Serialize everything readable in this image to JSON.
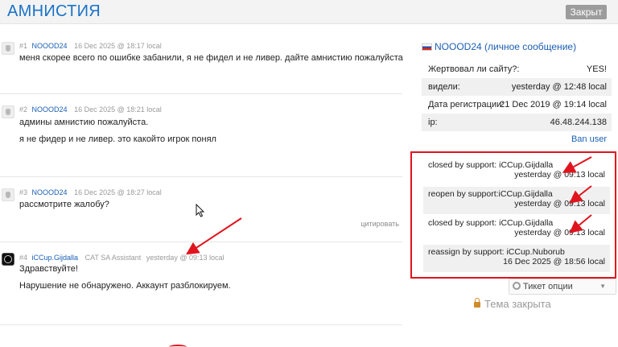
{
  "header": {
    "title": "АМНИСТИЯ",
    "status_badge": "Закрыт"
  },
  "posts": [
    {
      "number": "#1",
      "author": "NOOOD24",
      "role": "",
      "time": "16 Dec 2025 @ 18:17 local",
      "lines": [
        "меня скорее всего по ошибке забанили, я не фидел и не ливер. дайте амнистию пожалуйста"
      ]
    },
    {
      "number": "#2",
      "author": "NOOOD24",
      "role": "",
      "time": "16 Dec 2025 @ 18:21 local",
      "lines": [
        "админы амнистию пожалуйста.",
        "я не фидер и не ливер. это какойто игрок понял"
      ]
    },
    {
      "number": "#3",
      "author": "NOOOD24",
      "role": "",
      "time": "16 Dec 2025 @ 18:27 local",
      "lines": [
        "рассмотрите жалобу?"
      ],
      "quote_label": "цитировать"
    },
    {
      "number": "#4",
      "author": "iCCup.Gijdalla",
      "role": "CAT SA Assistant",
      "time": "yesterday @ 09:13 local",
      "lines": [
        "Здравствуйте!",
        "Нарушение не обнаружено. Аккаунт разблокируем."
      ]
    }
  ],
  "sidebar": {
    "user": {
      "name": "NOOOD24",
      "pm_label": "(личное сообщение)"
    },
    "info": [
      {
        "label": "Жертвовал ли сайту?:",
        "value": "YES!"
      },
      {
        "label": "видели:",
        "value": "yesterday @ 12:48 local"
      },
      {
        "label": "Дата регистрации:",
        "value": "21 Dec 2019 @ 19:14 local"
      },
      {
        "label": "ip:",
        "value": "46.48.244.138"
      }
    ],
    "ban_label": "Ban user",
    "log": [
      {
        "action": "closed by support: iCCup.Gijdalla",
        "time": "yesterday @ 09:13 local"
      },
      {
        "action": "reopen by support:iCCup.Gijdalla",
        "time": "yesterday @ 09:13 local"
      },
      {
        "action": "closed by support: iCCup.Gijdalla",
        "time": "yesterday @ 09:13 local"
      },
      {
        "action": "reassign by support: iCCup.Nuborub",
        "time": "16 Dec 2025 @ 18:56 local"
      }
    ],
    "ticket_options_label": "Тикет опции",
    "closed_label": "Тема закрыта"
  },
  "colors": {
    "accent": "#1a73c9",
    "link": "#1a5fb4",
    "annotation": "#e0141e",
    "badge": "#9c9c9c"
  }
}
